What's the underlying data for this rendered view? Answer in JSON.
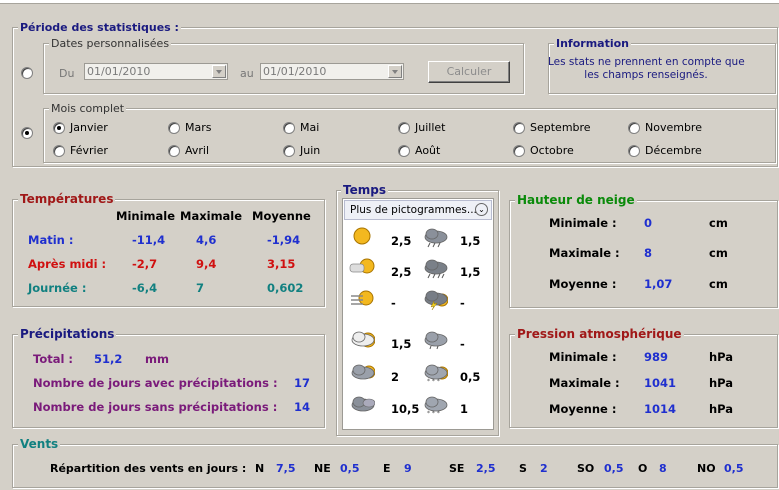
{
  "periode": {
    "title": "Période des statistiques :",
    "dates_legend": "Dates personnalisées",
    "du_label": "Du",
    "au_label": "au",
    "date_from": "01/01/2010",
    "date_to": "01/01/2010",
    "calc_button": "Calculer",
    "info_legend": "Information",
    "info_line1": "Les stats ne prennent en compte que",
    "info_line2": "les champs renseignés.",
    "mois_legend": "Mois complet",
    "months": [
      "Janvier",
      "Février",
      "Mars",
      "Avril",
      "Mai",
      "Juin",
      "Juillet",
      "Août",
      "Septembre",
      "Octobre",
      "Novembre",
      "Décembre"
    ],
    "selected_month": "Janvier"
  },
  "temperatures": {
    "title": "Températures",
    "col_min": "Minimale",
    "col_max": "Maximale",
    "col_avg": "Moyenne",
    "rows": [
      {
        "label": "Matin :",
        "min": "-11,4",
        "max": "4,6",
        "avg": "-1,94",
        "color": "#1f2fcf"
      },
      {
        "label": "Après midi :",
        "min": "-2,7",
        "max": "9,4",
        "avg": "3,15",
        "color": "#d01010"
      },
      {
        "label": "Journée :",
        "min": "-6,4",
        "max": "7",
        "avg": "0,602",
        "color": "#118080"
      }
    ]
  },
  "temps": {
    "title": "Temps",
    "dropdown": "Plus de pictogrammes...",
    "rows": [
      {
        "left_icon": "sun-icon",
        "left_val": "2,5",
        "right_icon": "cloud-rain-icon",
        "right_val": "1,5"
      },
      {
        "left_icon": "sun-haze-icon",
        "left_val": "2,5",
        "right_icon": "cloud-heavy-rain-icon",
        "right_val": "1,5"
      },
      {
        "left_icon": "fog-sun-icon",
        "left_val": "-",
        "right_icon": "thunderstorm-icon",
        "right_val": "-"
      },
      {
        "left_icon": "partly-cloudy-icon",
        "left_val": "1,5",
        "right_icon": "cloud-drizzle-icon",
        "right_val": "-"
      },
      {
        "left_icon": "mostly-cloudy-icon",
        "left_val": "2",
        "right_icon": "snow-shower-icon",
        "right_val": "0,5"
      },
      {
        "left_icon": "overcast-icon",
        "left_val": "10,5",
        "right_icon": "snow-icon",
        "right_val": "1"
      }
    ]
  },
  "neige": {
    "title": "Hauteur de neige",
    "rows": [
      {
        "label": "Minimale :",
        "value": "0",
        "unit": "cm"
      },
      {
        "label": "Maximale :",
        "value": "8",
        "unit": "cm"
      },
      {
        "label": "Moyenne :",
        "value": "1,07",
        "unit": "cm"
      }
    ]
  },
  "precip": {
    "title": "Précipitations",
    "total_label": "Total :",
    "total_value": "51,2",
    "total_unit": "mm",
    "with_label": "Nombre de jours avec précipitations :",
    "with_value": "17",
    "without_label": "Nombre de jours sans précipitations :",
    "without_value": "14"
  },
  "pression": {
    "title": "Pression atmosphérique",
    "rows": [
      {
        "label": "Minimale :",
        "value": "989",
        "unit": "hPa"
      },
      {
        "label": "Maximale :",
        "value": "1041",
        "unit": "hPa"
      },
      {
        "label": "Moyenne :",
        "value": "1014",
        "unit": "hPa"
      }
    ]
  },
  "vents": {
    "title": "Vents",
    "label": "Répartition des vents en jours :",
    "items": [
      {
        "dir": "N",
        "value": "7,5"
      },
      {
        "dir": "NE",
        "value": "0,5"
      },
      {
        "dir": "E",
        "value": "9"
      },
      {
        "dir": "SE",
        "value": "2,5"
      },
      {
        "dir": "S",
        "value": "2"
      },
      {
        "dir": "SO",
        "value": "0,5"
      },
      {
        "dir": "O",
        "value": "8"
      },
      {
        "dir": "NO",
        "value": "0,5"
      }
    ]
  },
  "colors": {
    "navy_title": "#1a1a80",
    "red_title": "#a01818",
    "green_title": "#0a8a0a",
    "teal_title": "#118080",
    "value_blue": "#1f2fcf",
    "purple": "#7a1a7a"
  }
}
